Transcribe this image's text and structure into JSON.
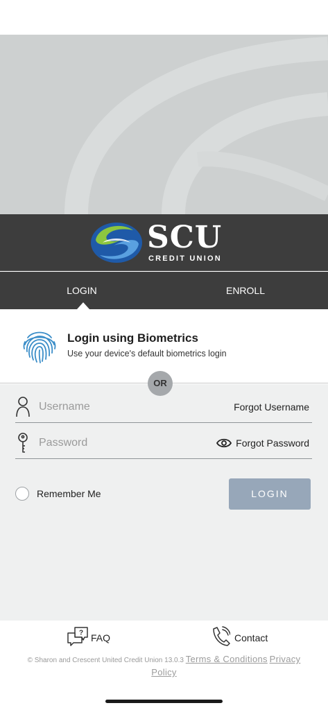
{
  "brand": {
    "name": "SCU",
    "subtitle": "CREDIT UNION",
    "colors": {
      "green": "#8dc63f",
      "blue": "#1f5aa8",
      "dark_bar": "#3d3d3d"
    }
  },
  "tabs": [
    {
      "label": "LOGIN",
      "active": true
    },
    {
      "label": "ENROLL",
      "active": false
    }
  ],
  "biometrics": {
    "title": "Login using Biometrics",
    "subtitle": "Use your device's default biometrics login",
    "icon": "fingerprint-icon"
  },
  "divider_label": "OR",
  "form": {
    "username": {
      "placeholder": "Username",
      "value": "",
      "icon": "user-icon"
    },
    "forgot_username": "Forgot Username",
    "password": {
      "placeholder": "Password",
      "value": "",
      "icon": "key-icon"
    },
    "forgot_password": "Forgot Password",
    "show_password_icon": "eye-icon",
    "remember_me": "Remember Me",
    "remember_checked": false,
    "login_button": "LOGIN"
  },
  "footer": {
    "faq": {
      "label": "FAQ",
      "icon": "faq-chat-icon"
    },
    "contact": {
      "label": "Contact",
      "icon": "phone-icon"
    },
    "copyright": "© Sharon and Crescent United Credit Union 13.0.3",
    "terms": "Terms & Conditions",
    "privacy": "Privacy Policy"
  }
}
